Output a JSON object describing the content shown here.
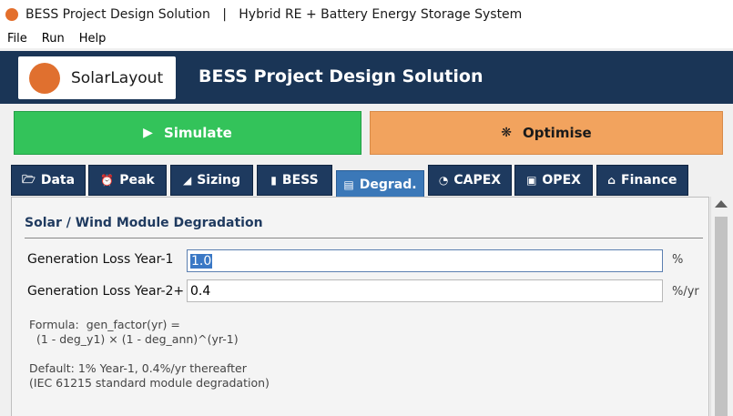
{
  "window": {
    "title": "BESS Project Design Solution   |   Hybrid RE + Battery Energy Storage System"
  },
  "menu": [
    "File",
    "Run",
    "Help"
  ],
  "header": {
    "logo_text": "SolarLayout",
    "title": "BESS Project Design Solution"
  },
  "actions": {
    "simulate": {
      "label": "Simulate",
      "icon": "play-icon",
      "color": "#33c35a"
    },
    "optimise": {
      "label": "Optimise",
      "icon": "gear-icon",
      "color": "#f2a35e"
    }
  },
  "tabs": [
    {
      "label": "Data",
      "icon": "folder-icon"
    },
    {
      "label": "Peak",
      "icon": "alarm-clock-icon"
    },
    {
      "label": "Sizing",
      "icon": "ruler-icon"
    },
    {
      "label": "BESS",
      "icon": "battery-icon"
    },
    {
      "label": "Degrad.",
      "icon": "chart-icon",
      "active": true
    },
    {
      "label": "CAPEX",
      "icon": "money-bag-icon"
    },
    {
      "label": "OPEX",
      "icon": "calendar-icon"
    },
    {
      "label": "Finance",
      "icon": "bank-icon"
    }
  ],
  "degradation": {
    "section_title": "Solar / Wind Module Degradation",
    "year1": {
      "label": "Generation Loss Year-1",
      "value": "1.0",
      "unit": "%"
    },
    "year2": {
      "label": "Generation Loss Year-2+",
      "value": "0.4",
      "unit": "%/yr"
    },
    "formula_line1": "Formula:  gen_factor(yr) =",
    "formula_line2": "  (1 - deg_y1) × (1 - deg_ann)^(yr-1)",
    "default_line1": "Default: 1% Year-1, 0.4%/yr thereafter",
    "default_line2": "(IEC 61215 standard module degradation)"
  },
  "colors": {
    "header_bg": "#1a3556",
    "tab_bg": "#1e3a5f",
    "tab_active": "#3b78b8",
    "accent_orange": "#e0702f"
  }
}
